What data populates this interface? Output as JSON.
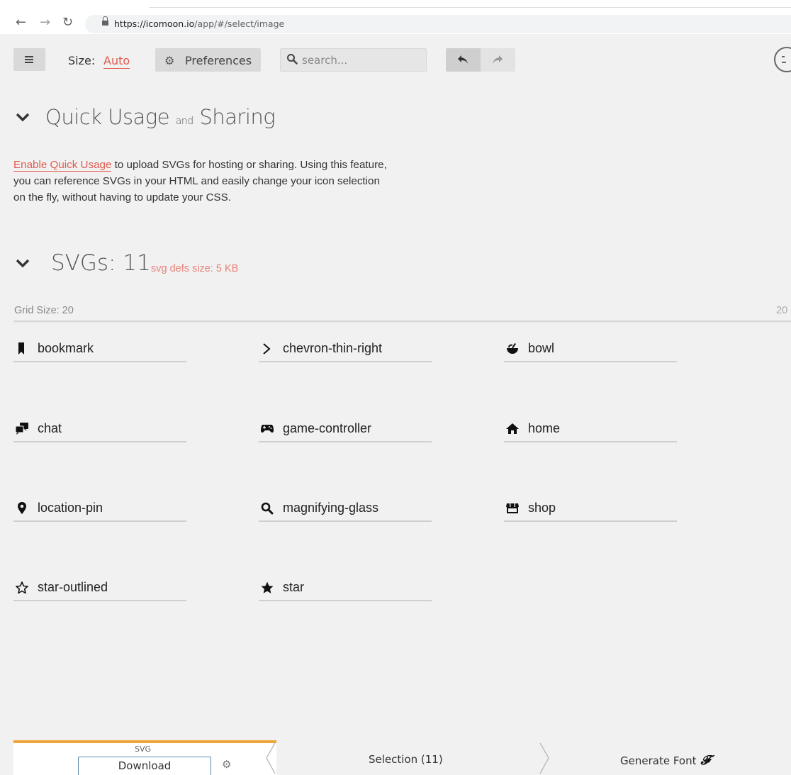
{
  "browser": {
    "url_host": "https://icomoon.io",
    "url_path": "/app/#/select/image"
  },
  "toolbar": {
    "size_label": "Size:",
    "size_value": "Auto",
    "preferences_label": "Preferences",
    "search_placeholder": "search..."
  },
  "quick_usage": {
    "title_main": "Quick Usage",
    "title_and": "and",
    "title_end": "Sharing",
    "link_text": "Enable Quick Usage",
    "line1_rest": " to upload SVGs for hosting or sharing. Using this feature,",
    "line2": "you can reference SVGs in your HTML and easily change your icon selection",
    "line3": "on the fly, without having to update your CSS."
  },
  "svgs": {
    "title": "SVGs: 11",
    "defs_size": "svg defs size: 5 KB",
    "grid_label": "Grid Size: 20",
    "grid_value": "20"
  },
  "glyphs": [
    {
      "name": "bookmark",
      "icon": "bookmark-icon"
    },
    {
      "name": "chevron-thin-right",
      "icon": "chevron-thin-right-icon"
    },
    {
      "name": "bowl",
      "icon": "bowl-icon"
    },
    {
      "name": "chat",
      "icon": "chat-icon"
    },
    {
      "name": "game-controller",
      "icon": "game-controller-icon"
    },
    {
      "name": "home",
      "icon": "home-icon"
    },
    {
      "name": "location-pin",
      "icon": "location-pin-icon"
    },
    {
      "name": "magnifying-glass",
      "icon": "magnifying-glass-icon"
    },
    {
      "name": "shop",
      "icon": "shop-icon"
    },
    {
      "name": "star-outlined",
      "icon": "star-outlined-icon"
    },
    {
      "name": "star",
      "icon": "star-icon"
    }
  ],
  "footer": {
    "format_label": "SVG",
    "download_label": "Download",
    "selection_label": "Selection (11)",
    "generate_label": "Generate Font",
    "generate_glyph": "𝓕"
  },
  "colors": {
    "accent": "#e05a4f",
    "accent_light": "#e8827a",
    "footer_highlight": "#f0a53a",
    "background": "#f1f1f1"
  }
}
